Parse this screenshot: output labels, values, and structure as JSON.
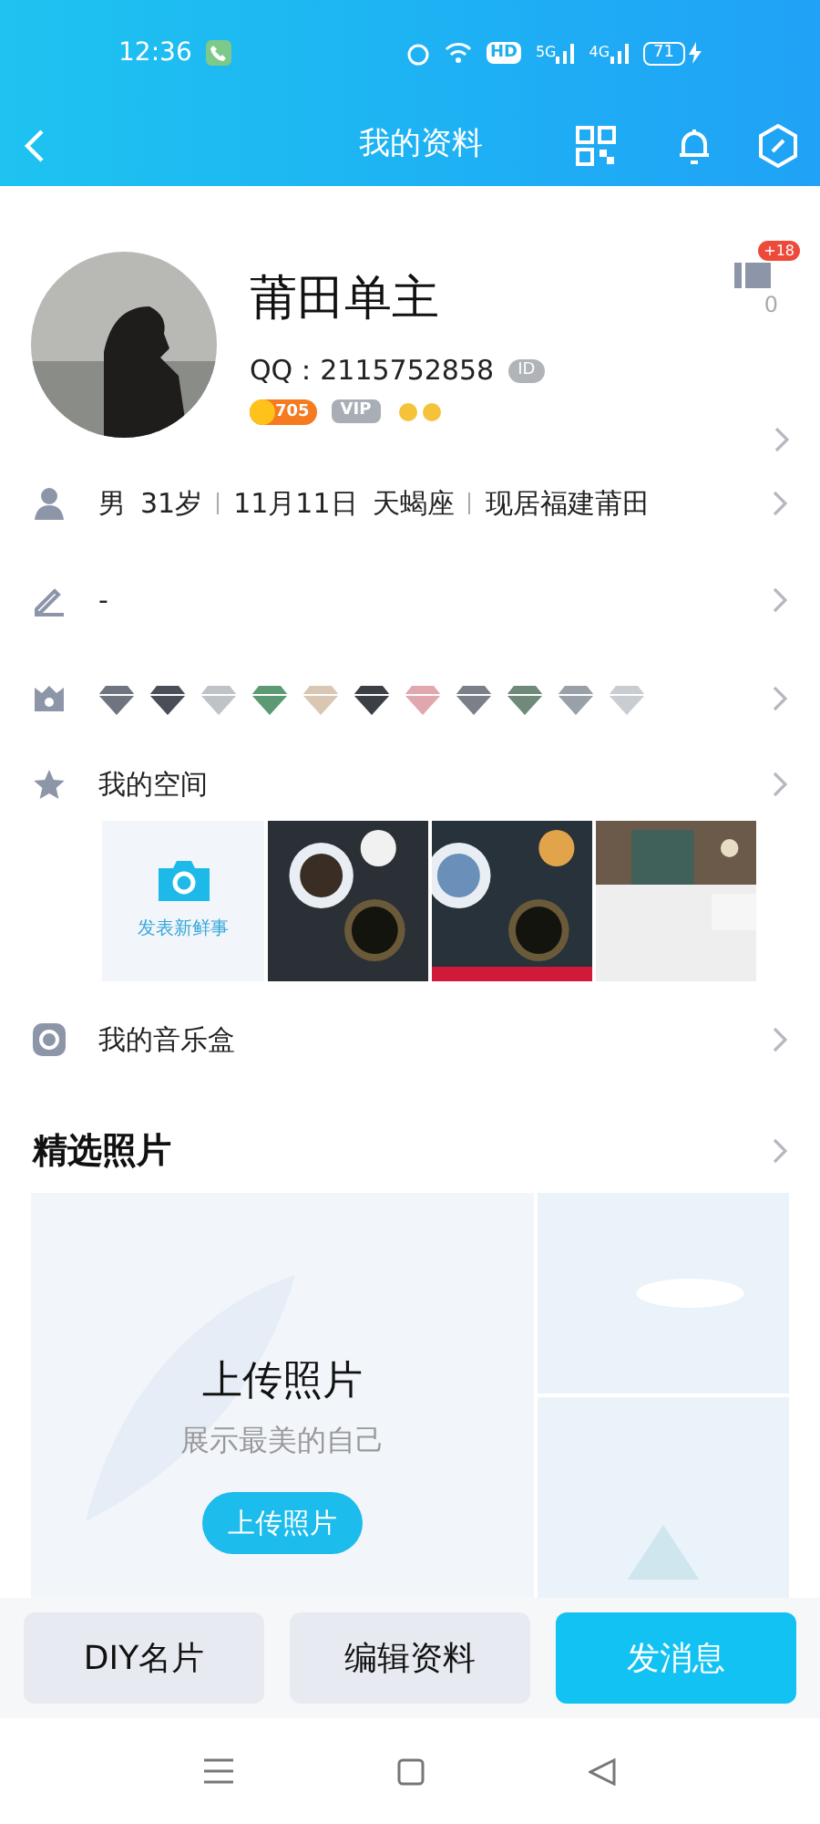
{
  "status_bar": {
    "time": "12:36",
    "hd": "HD",
    "net_1": "5G",
    "net_2": "4G",
    "battery": "71"
  },
  "header": {
    "title": "我的资料"
  },
  "profile": {
    "name": "莆田单主",
    "qq": "QQ：2115752858",
    "id_tag": "ID",
    "level": "705",
    "vip": "VIP",
    "likes_badge": "+18",
    "likes": "0"
  },
  "info_row": {
    "parts": [
      "男",
      "31岁",
      "11月11日",
      "天蝎座",
      "现居福建莆田"
    ]
  },
  "signature": {
    "text": "-"
  },
  "space": {
    "title": "我的空间",
    "post_label": "发表新鲜事"
  },
  "music": {
    "title": "我的音乐盒"
  },
  "featured": {
    "title": "精选照片",
    "upload_title": "上传照片",
    "upload_subtitle": "展示最美的自己",
    "upload_button": "上传照片"
  },
  "actions": [
    {
      "label": "DIY名片",
      "primary": false
    },
    {
      "label": "编辑资料",
      "primary": false
    },
    {
      "label": "发消息",
      "primary": true
    }
  ]
}
